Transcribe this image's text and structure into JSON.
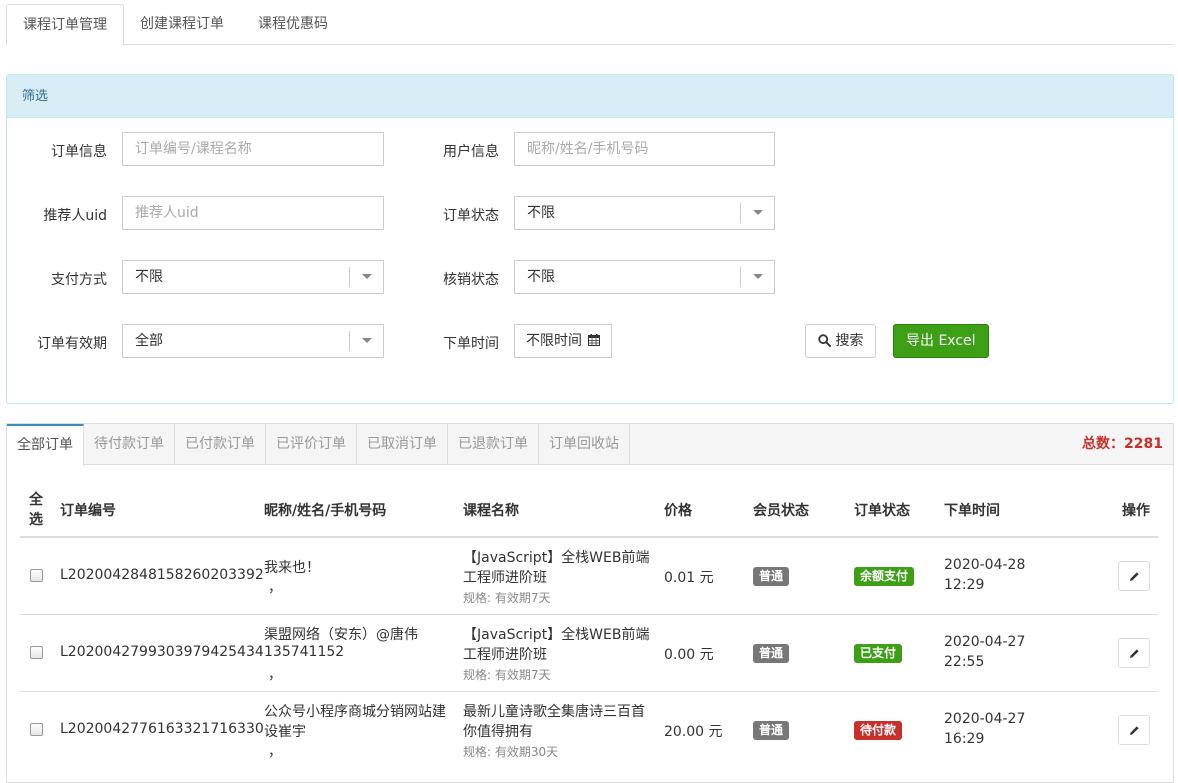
{
  "top_tabs": [
    "课程订单管理",
    "创建课程订单",
    "课程优惠码"
  ],
  "filter": {
    "title": "筛选",
    "order_info_label": "订单信息",
    "order_info_placeholder": "订单编号/课程名称",
    "user_info_label": "用户信息",
    "user_info_placeholder": "昵称/姓名/手机号码",
    "referrer_label": "推荐人uid",
    "referrer_placeholder": "推荐人uid",
    "order_status_label": "订单状态",
    "order_status_value": "不限",
    "pay_method_label": "支付方式",
    "pay_method_value": "不限",
    "verify_status_label": "核销状态",
    "verify_status_value": "不限",
    "validity_label": "订单有效期",
    "validity_value": "全部",
    "order_time_label": "下单时间",
    "order_time_value": "不限时间",
    "search_label": "搜索",
    "export_label": "导出 Excel"
  },
  "order_tabs": [
    "全部订单",
    "待付款订单",
    "已付款订单",
    "已评价订单",
    "已取消订单",
    "已退款订单",
    "订单回收站"
  ],
  "total_label": "总数：2281",
  "table": {
    "headers": [
      "全",
      "选",
      "订单编号",
      "昵称/姓名/手机号码",
      "课程名称",
      "价格",
      "会员状态",
      "订单状态",
      "下单时间",
      "操作"
    ],
    "rows": [
      {
        "order_no": "L2020042848158260203392",
        "user_line1": "我来也！",
        "user_line2": "",
        "user_line3": "，",
        "course_line1": "【JavaScript】全栈WEB前端",
        "course_line2": "工程师进阶班",
        "spec": "规格: 有效期7天",
        "price": "0.01 元",
        "member": "普通",
        "status": "余额支付",
        "status_color": "#3c9f15",
        "date": "2020-04-28",
        "time": "12:29"
      },
      {
        "order_no": "L2020042799303979425434",
        "user_line1": "渠盟网络（安东）@唐伟",
        "user_line2": "135741152",
        "user_line3": "，",
        "course_line1": "【JavaScript】全栈WEB前端",
        "course_line2": "工程师进阶班",
        "spec": "规格: 有效期7天",
        "price": "0.00 元",
        "member": "普通",
        "status": "已支付",
        "status_color": "#3c9f15",
        "date": "2020-04-27",
        "time": "22:55"
      },
      {
        "order_no": "L2020042776163321716330",
        "user_line1": "公众号小程序商城分销网站建",
        "user_line2": "设崔宇",
        "user_line3": "，",
        "course_line1": "最新儿童诗歌全集唐诗三百首",
        "course_line2": "你值得拥有",
        "spec": "规格: 有效期30天",
        "price": "20.00 元",
        "member": "普通",
        "status": "待付款",
        "status_color": "#c9302c",
        "date": "2020-04-27",
        "time": "16:29"
      }
    ]
  },
  "colors": {
    "panel_head_bg": "#d9edf7",
    "export_green": "#3c9f15",
    "total_red": "#c9302c",
    "member_badge_gray": "#777777"
  }
}
